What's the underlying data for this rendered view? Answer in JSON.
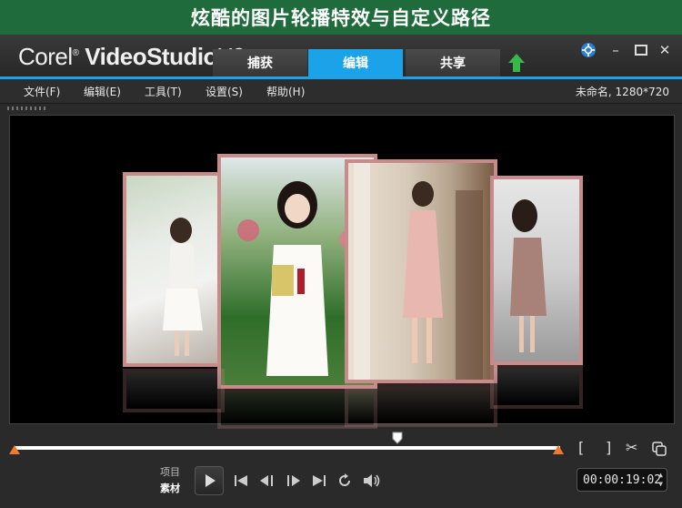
{
  "banner": {
    "title": "炫酷的图片轮播特效与自定义路径"
  },
  "app": {
    "logo_brand": "Corel",
    "logo_product": "VideoStudio",
    "logo_version": "X9"
  },
  "tabs": [
    {
      "label": "捕获",
      "active": false
    },
    {
      "label": "编辑",
      "active": true
    },
    {
      "label": "共享",
      "active": false
    }
  ],
  "menu": [
    {
      "label": "文件(F)"
    },
    {
      "label": "编辑(E)"
    },
    {
      "label": "工具(T)"
    },
    {
      "label": "设置(S)"
    },
    {
      "label": "帮助(H)"
    }
  ],
  "project": {
    "info": "未命名, 1280*720"
  },
  "controls": {
    "project_label": "项目",
    "clip_label": "素材",
    "timecode": "00:00:19:02"
  },
  "colors": {
    "accent": "#1aa3e8",
    "banner": "#1f6b3c",
    "trim_marker": "#f07a2a",
    "frame": "#c98a8a"
  },
  "icons": [
    "help-icon",
    "minimize-icon",
    "maximize-icon",
    "close-icon",
    "upload-icon",
    "mark-in-icon",
    "mark-out-icon",
    "split-icon",
    "copy-icon",
    "play-icon",
    "home-icon",
    "prev-frame-icon",
    "next-frame-icon",
    "end-icon",
    "repeat-icon",
    "volume-icon"
  ]
}
